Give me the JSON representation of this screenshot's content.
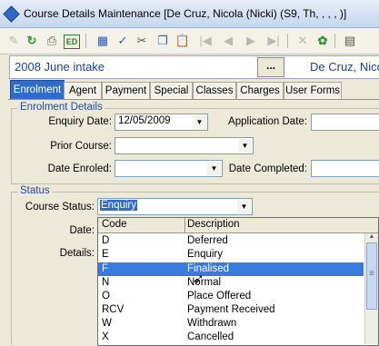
{
  "window": {
    "title": "Course Details Maintenance  [De Cruz, Nicola (Nicki) (S9, Th, , , , )]"
  },
  "toolbar": {
    "icons": [
      "edit-icon",
      "refresh-icon",
      "print-icon",
      "ed-icon",
      "calculator-icon",
      "spellcheck-icon",
      "cut-icon",
      "copy-icon",
      "paste-icon",
      "first-record-icon",
      "previous-record-icon",
      "next-record-icon",
      "last-record-icon",
      "delete-icon",
      "find-icon",
      "columns-icon"
    ],
    "ed_label": "ED"
  },
  "intake": {
    "value": "2008 June intake",
    "ellipsis": "...",
    "student": "De Cruz, Nicola"
  },
  "tabs": [
    {
      "label": "Enrolment",
      "active": true
    },
    {
      "label": "Agent"
    },
    {
      "label": "Payment"
    },
    {
      "label": "Special"
    },
    {
      "label": "Classes"
    },
    {
      "label": "Charges"
    },
    {
      "label": "User Forms"
    }
  ],
  "enrolment_details": {
    "legend": "Enrolment Details",
    "enquiry_date_label": "Enquiry Date:",
    "enquiry_date_value": "12/05/2009",
    "application_date_label": "Application Date:",
    "prior_course_label": "Prior Course:",
    "date_enroled_label": "Date Enroled:",
    "date_completed_label": "Date Completed:"
  },
  "status": {
    "legend": "Status",
    "course_status_label": "Course Status:",
    "course_status_value": "Enquiry",
    "date_label": "Date:",
    "details_label": "Details:"
  },
  "dropdown": {
    "headers": [
      "Code",
      "Description"
    ],
    "rows": [
      {
        "code": "D",
        "description": "Deferred"
      },
      {
        "code": "E",
        "description": "Enquiry"
      },
      {
        "code": "F",
        "description": "Finalised",
        "highlighted": true
      },
      {
        "code": "N",
        "description": "Normal"
      },
      {
        "code": "O",
        "description": "Place Offered"
      },
      {
        "code": "RCV",
        "description": "Payment Received"
      },
      {
        "code": "W",
        "description": "Withdrawn"
      },
      {
        "code": "X",
        "description": "Cancelled"
      }
    ]
  }
}
